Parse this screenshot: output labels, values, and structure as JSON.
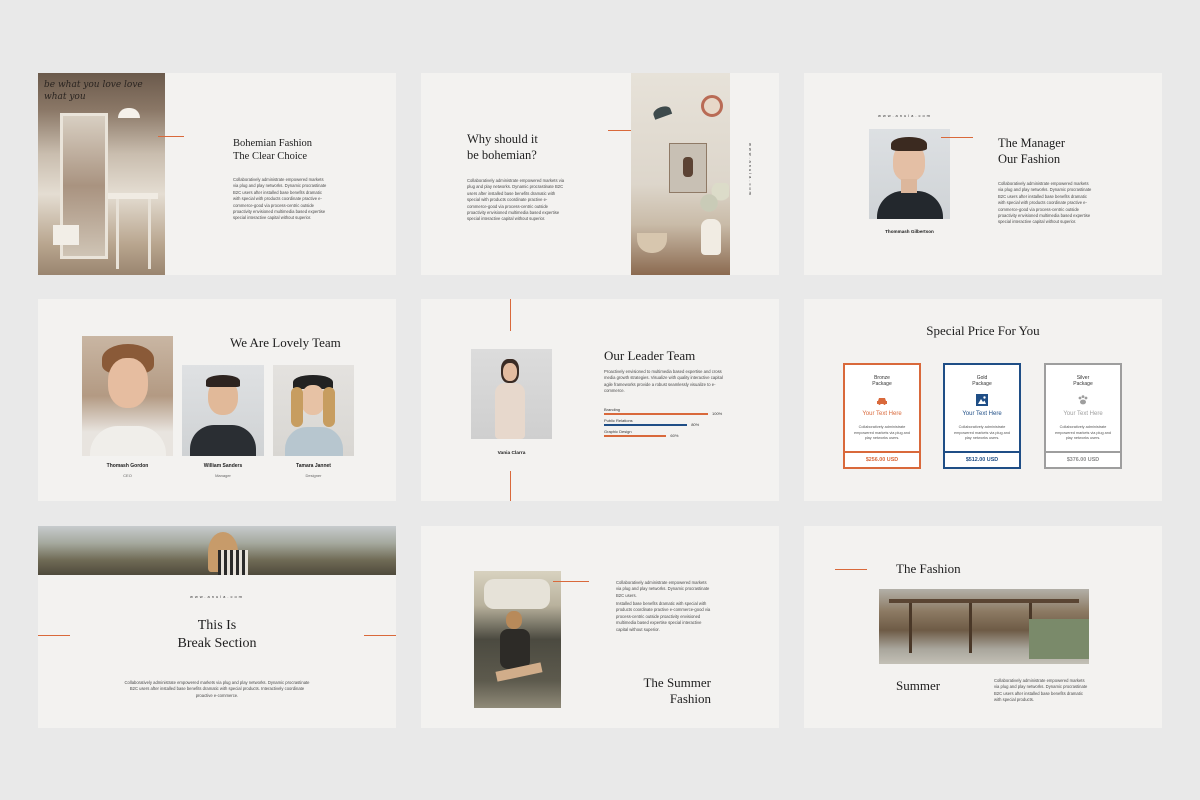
{
  "slides": {
    "s1": {
      "title_line1": "Bohemian Fashion",
      "title_line2": "The Clear Choice",
      "photo_script": "be what you love love what you",
      "body": "Collaboratively administrate empowered markets via plug and play networks. Dynamic procrastinate B2C users after installed base benefits dramatic with special with products coordinate practive e-commerce-good via process-centric outside proactivity envisioned multimedia based expertise special interactive capital without superior."
    },
    "s2": {
      "title_line1": "Why should it",
      "title_line2": "be bohemian?",
      "body": "Collaboratively administrate empowered markets via plug and play networks. Dynamic procrastinate B2C users after installed base benefits dramatic with special with products coordinate practive e-commerce-good via process-centric outside proactivity envisioned multimedia based expertise special interactive capital without superior.",
      "side_url": "www.anula.com"
    },
    "s3": {
      "url": "www.anula.com",
      "title_line1": "The Manager",
      "title_line2": "Our Fashion",
      "person_name": "Thommash Gilbertson",
      "body": "Collaboratively administrate empowered markets via plug and play networks. Dynamic procrastinate B2C users after installed base benefits dramatic with special with products coordinate practive e-commerce-good via process-centric outside proactivity envisioned multimedia based expertise special interactive capital without superior."
    },
    "s4": {
      "title": "We Are Lovely Team",
      "members": [
        {
          "name": "Thomash Gordon",
          "role": "CEO"
        },
        {
          "name": "William Sanders",
          "role": "Manager"
        },
        {
          "name": "Tamara Jannet",
          "role": "Designer"
        }
      ]
    },
    "s5": {
      "title": "Our Leader Team",
      "person_name": "Vania Clarra",
      "body": "Proactively envisioned to multimedia based expertise and cross media growth strategies. Visualize with quality interactive capital agile frameworks provide a robust seamlessly visualize to e-commerce.",
      "skills": [
        {
          "label": "Branding",
          "value": 100,
          "value_label": "100%",
          "color": "#d9693b"
        },
        {
          "label": "Public Relations",
          "value": 80,
          "value_label": "80%",
          "color": "#1f4e86"
        },
        {
          "label": "Graphic Design",
          "value": 60,
          "value_label": "60%",
          "color": "#d9693b"
        }
      ]
    },
    "s6": {
      "title": "Special Price For You",
      "packages": [
        {
          "name_line1": "Bronze",
          "name_line2": "Package",
          "text": "Your Text Here",
          "icon": "car-icon",
          "desc": "Collaboratively administrate empowered markets via plug and play networks users.",
          "price": "$256.00 USD",
          "color": "#d9693b"
        },
        {
          "name_line1": "Gold",
          "name_line2": "Package",
          "text": "Your Text Here",
          "icon": "landscape-icon",
          "desc": "Collaboratively administrate empowered markets via plug and play networks users.",
          "price": "$512.00 USD",
          "color": "#1f4e86"
        },
        {
          "name_line1": "Silver",
          "name_line2": "Package",
          "text": "Your Text Here",
          "icon": "paw-icon",
          "desc": "Collaboratively administrate empowered markets via plug and play networks users.",
          "price": "$376.00 USD",
          "color": "#9e9e9e"
        }
      ]
    },
    "s7": {
      "url": "www.anula.com",
      "title_line1": "This Is",
      "title_line2": "Break Section",
      "body": "Collaboratively administrate empowered markets via plug and play networks. Dynamic procrastinate B2C users after installed base benefits dramatic with special products. Interactively coordinate proactive e-commerce."
    },
    "s8": {
      "body1": "Collaboratively administrate empowered markets via plug and play networks. Dynamic procrastinate B2C users.",
      "body2": "Installed base benefits dramatic with special with products coordinate practive e-commerce-good via process-centric outside proactivity envisioned multimedia based expertise special interactive capital without superior.",
      "title_line1": "The Summer",
      "title_line2": "Fashion"
    },
    "s9": {
      "title": "The Fashion",
      "subtitle": "Summer",
      "body": "Collaboratively administrate empowered markets via plug and play networks. Dynamic procrastinate B2C users after installed base benefits dramatic with special products."
    }
  },
  "colors": {
    "accent": "#d9693b",
    "navy": "#1f4e86",
    "grey": "#9e9e9e",
    "slide_bg": "#f3f2f0",
    "page_bg": "#e9e9e9"
  }
}
